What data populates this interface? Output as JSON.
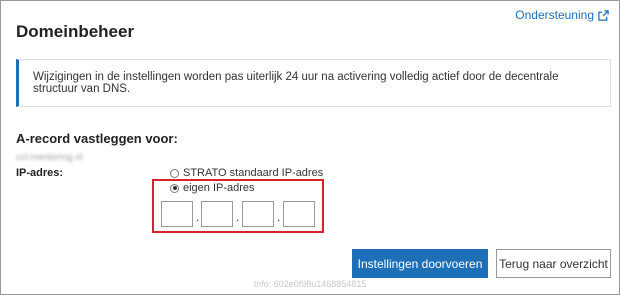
{
  "header": {
    "support_label": "Ondersteuning",
    "title": "Domeinbeheer"
  },
  "notice": {
    "text": "Wijzigingen in de instellingen worden pas uiterlijk 24 uur na activering volledig actief door de decentrale structuur van DNS."
  },
  "form": {
    "section_title": "A-record vastleggen voor:",
    "domain": "ccl-mentoring.nl",
    "ip_label": "IP-adres:",
    "options": [
      {
        "label": "STRATO standaard IP-adres",
        "selected": false
      },
      {
        "label": "eigen IP-adres",
        "selected": true
      }
    ],
    "octets": [
      "",
      "",
      "",
      ""
    ],
    "separator": "."
  },
  "buttons": {
    "apply": "Instellingen doorvoeren",
    "back": "Terug naar overzicht"
  },
  "footer": {
    "info": "Info: 602e0f98u1468854815"
  },
  "colors": {
    "accent": "#1d6fb8",
    "highlight": "#d9232c"
  }
}
